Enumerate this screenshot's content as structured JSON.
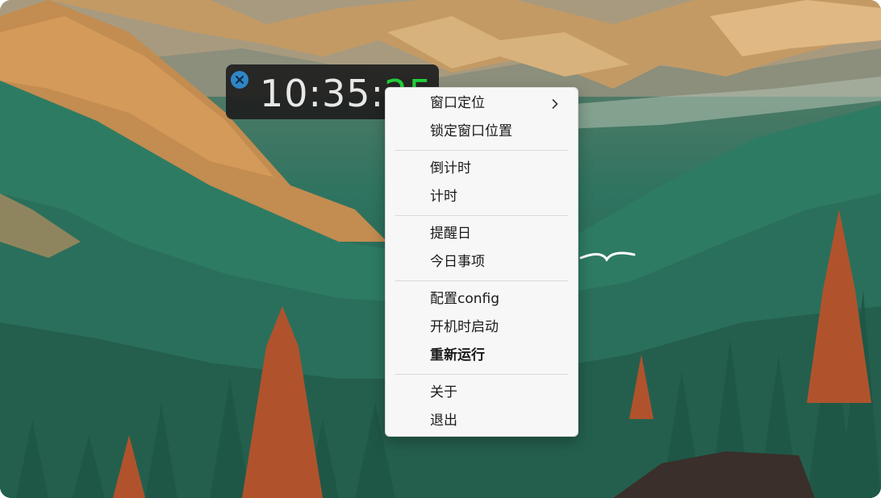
{
  "clock": {
    "time_main": "10:35:",
    "time_seconds": "25",
    "close_icon": "close-icon",
    "seconds_color": "#22d23a"
  },
  "menu": {
    "groups": [
      [
        {
          "label": "窗口定位",
          "submenu": true
        },
        {
          "label": "锁定窗口位置"
        }
      ],
      [
        {
          "label": "倒计时"
        },
        {
          "label": "计时"
        }
      ],
      [
        {
          "label": "提醒日"
        },
        {
          "label": "今日事项"
        }
      ],
      [
        {
          "label": "配置config"
        },
        {
          "label": "开机时启动"
        },
        {
          "label": "重新运行",
          "bold": true
        }
      ],
      [
        {
          "label": "关于"
        },
        {
          "label": "退出"
        }
      ]
    ]
  }
}
